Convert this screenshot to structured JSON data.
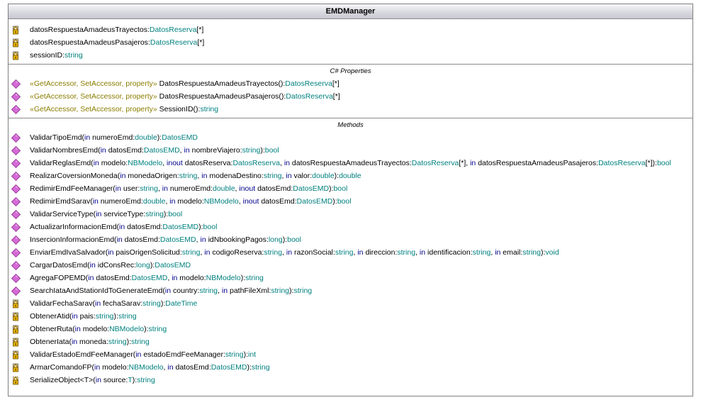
{
  "class_name": "EMDManager",
  "colors": {
    "keyword": "#00008b",
    "type": "#00807f",
    "stereotype": "#8b7d00",
    "method_icon": "#d56ad6"
  },
  "fields": [
    {
      "icon": "lock-icon",
      "parts": [
        {
          "t": "datosRespuestaAmadeusTrayectos:",
          "c": "id"
        },
        {
          "t": "DatosReserva",
          "c": "ty"
        },
        {
          "t": "[*]",
          "c": "id"
        }
      ]
    },
    {
      "icon": "lock-icon",
      "parts": [
        {
          "t": "datosRespuestaAmadeusPasajeros:",
          "c": "id"
        },
        {
          "t": "DatosReserva",
          "c": "ty"
        },
        {
          "t": "[*]",
          "c": "id"
        }
      ]
    },
    {
      "icon": "lock-icon",
      "parts": [
        {
          "t": "sessionID:",
          "c": "id"
        },
        {
          "t": "string",
          "c": "ty"
        }
      ]
    }
  ],
  "properties_header": "C# Properties",
  "properties": [
    {
      "icon": "method-icon",
      "parts": [
        {
          "t": "«GetAccessor, SetAccessor, property» ",
          "c": "st"
        },
        {
          "t": "DatosRespuestaAmadeusTrayectos():",
          "c": "id"
        },
        {
          "t": "DatosReserva",
          "c": "ty"
        },
        {
          "t": "[*]",
          "c": "id"
        }
      ]
    },
    {
      "icon": "method-icon",
      "parts": [
        {
          "t": "«GetAccessor, SetAccessor, property» ",
          "c": "st"
        },
        {
          "t": "DatosRespuestaAmadeusPasajeros():",
          "c": "id"
        },
        {
          "t": "DatosReserva",
          "c": "ty"
        },
        {
          "t": "[*]",
          "c": "id"
        }
      ]
    },
    {
      "icon": "method-icon",
      "parts": [
        {
          "t": "«GetAccessor, SetAccessor, property» ",
          "c": "st"
        },
        {
          "t": "SessionID():",
          "c": "id"
        },
        {
          "t": "string",
          "c": "ty"
        }
      ]
    }
  ],
  "methods_header": "Methods",
  "methods": [
    {
      "icon": "method-icon",
      "parts": [
        {
          "t": "ValidarTipoEmd(",
          "c": "id"
        },
        {
          "t": "in",
          "c": "kw"
        },
        {
          "t": " numeroEmd:",
          "c": "id"
        },
        {
          "t": "double",
          "c": "ty"
        },
        {
          "t": "):",
          "c": "id"
        },
        {
          "t": "DatosEMD",
          "c": "ty"
        }
      ]
    },
    {
      "icon": "method-icon",
      "parts": [
        {
          "t": "ValidarNombresEmd(",
          "c": "id"
        },
        {
          "t": "in",
          "c": "kw"
        },
        {
          "t": " datosEmd:",
          "c": "id"
        },
        {
          "t": "DatosEMD",
          "c": "ty"
        },
        {
          "t": ", ",
          "c": "id"
        },
        {
          "t": "in",
          "c": "kw"
        },
        {
          "t": " nombreViajero:",
          "c": "id"
        },
        {
          "t": "string",
          "c": "ty"
        },
        {
          "t": "):",
          "c": "id"
        },
        {
          "t": "bool",
          "c": "ty"
        }
      ]
    },
    {
      "icon": "method-icon",
      "parts": [
        {
          "t": "ValidarReglasEmd(",
          "c": "id"
        },
        {
          "t": "in",
          "c": "kw"
        },
        {
          "t": " modelo:",
          "c": "id"
        },
        {
          "t": "NBModelo",
          "c": "ty"
        },
        {
          "t": ", ",
          "c": "id"
        },
        {
          "t": "inout",
          "c": "kw"
        },
        {
          "t": " datosReserva:",
          "c": "id"
        },
        {
          "t": "DatosReserva",
          "c": "ty"
        },
        {
          "t": ", ",
          "c": "id"
        },
        {
          "t": "in",
          "c": "kw"
        },
        {
          "t": " datosRespuestaAmadeusTrayectos:",
          "c": "id"
        },
        {
          "t": "DatosReserva",
          "c": "ty"
        },
        {
          "t": "[*], ",
          "c": "id"
        },
        {
          "t": "in",
          "c": "kw"
        },
        {
          "t": " datosRespuestaAmadeusPasajeros:",
          "c": "id"
        },
        {
          "t": "DatosReserva",
          "c": "ty"
        },
        {
          "t": "[*]):",
          "c": "id"
        },
        {
          "t": "bool",
          "c": "ty"
        }
      ]
    },
    {
      "icon": "method-icon",
      "parts": [
        {
          "t": "RealizarCoversionMoneda(",
          "c": "id"
        },
        {
          "t": "in",
          "c": "kw"
        },
        {
          "t": " monedaOrigen:",
          "c": "id"
        },
        {
          "t": "string",
          "c": "ty"
        },
        {
          "t": ", ",
          "c": "id"
        },
        {
          "t": "in",
          "c": "kw"
        },
        {
          "t": " modenaDestino:",
          "c": "id"
        },
        {
          "t": "string",
          "c": "ty"
        },
        {
          "t": ", ",
          "c": "id"
        },
        {
          "t": "in",
          "c": "kw"
        },
        {
          "t": " valor:",
          "c": "id"
        },
        {
          "t": "double",
          "c": "ty"
        },
        {
          "t": "):",
          "c": "id"
        },
        {
          "t": "double",
          "c": "ty"
        }
      ]
    },
    {
      "icon": "method-icon",
      "parts": [
        {
          "t": "RedimirEmdFeeManager(",
          "c": "id"
        },
        {
          "t": "in",
          "c": "kw"
        },
        {
          "t": " user:",
          "c": "id"
        },
        {
          "t": "string",
          "c": "ty"
        },
        {
          "t": ", ",
          "c": "id"
        },
        {
          "t": "in",
          "c": "kw"
        },
        {
          "t": " numeroEmd:",
          "c": "id"
        },
        {
          "t": "double",
          "c": "ty"
        },
        {
          "t": ", ",
          "c": "id"
        },
        {
          "t": "inout",
          "c": "kw"
        },
        {
          "t": " datosEmd:",
          "c": "id"
        },
        {
          "t": "DatosEMD",
          "c": "ty"
        },
        {
          "t": "):",
          "c": "id"
        },
        {
          "t": "bool",
          "c": "ty"
        }
      ]
    },
    {
      "icon": "method-icon",
      "parts": [
        {
          "t": "RedimirEmdSarav(",
          "c": "id"
        },
        {
          "t": "in",
          "c": "kw"
        },
        {
          "t": " numeroEmd:",
          "c": "id"
        },
        {
          "t": "double",
          "c": "ty"
        },
        {
          "t": ", ",
          "c": "id"
        },
        {
          "t": "in",
          "c": "kw"
        },
        {
          "t": " modelo:",
          "c": "id"
        },
        {
          "t": "NBModelo",
          "c": "ty"
        },
        {
          "t": ", ",
          "c": "id"
        },
        {
          "t": "inout",
          "c": "kw"
        },
        {
          "t": " datosEmd:",
          "c": "id"
        },
        {
          "t": "DatosEMD",
          "c": "ty"
        },
        {
          "t": "):",
          "c": "id"
        },
        {
          "t": "bool",
          "c": "ty"
        }
      ]
    },
    {
      "icon": "method-icon",
      "parts": [
        {
          "t": "ValidarServiceType(",
          "c": "id"
        },
        {
          "t": "in",
          "c": "kw"
        },
        {
          "t": " serviceType:",
          "c": "id"
        },
        {
          "t": "string",
          "c": "ty"
        },
        {
          "t": "):",
          "c": "id"
        },
        {
          "t": "bool",
          "c": "ty"
        }
      ]
    },
    {
      "icon": "method-icon",
      "parts": [
        {
          "t": "ActualizarInformacionEmd(",
          "c": "id"
        },
        {
          "t": "in",
          "c": "kw"
        },
        {
          "t": " datosEmd:",
          "c": "id"
        },
        {
          "t": "DatosEMD",
          "c": "ty"
        },
        {
          "t": "):",
          "c": "id"
        },
        {
          "t": "bool",
          "c": "ty"
        }
      ]
    },
    {
      "icon": "method-icon",
      "parts": [
        {
          "t": "InsercionInformacionEmd(",
          "c": "id"
        },
        {
          "t": "in",
          "c": "kw"
        },
        {
          "t": " datosEmd:",
          "c": "id"
        },
        {
          "t": "DatosEMD",
          "c": "ty"
        },
        {
          "t": ", ",
          "c": "id"
        },
        {
          "t": "in",
          "c": "kw"
        },
        {
          "t": " idNbookingPagos:",
          "c": "id"
        },
        {
          "t": "long",
          "c": "ty"
        },
        {
          "t": "):",
          "c": "id"
        },
        {
          "t": "bool",
          "c": "ty"
        }
      ]
    },
    {
      "icon": "method-icon",
      "parts": [
        {
          "t": "EnviarEmdIvaSalvador(",
          "c": "id"
        },
        {
          "t": "in",
          "c": "kw"
        },
        {
          "t": " paisOrigenSolicitud:",
          "c": "id"
        },
        {
          "t": "string",
          "c": "ty"
        },
        {
          "t": ", ",
          "c": "id"
        },
        {
          "t": "in",
          "c": "kw"
        },
        {
          "t": " codigoReserva:",
          "c": "id"
        },
        {
          "t": "string",
          "c": "ty"
        },
        {
          "t": ", ",
          "c": "id"
        },
        {
          "t": "in",
          "c": "kw"
        },
        {
          "t": " razonSocial:",
          "c": "id"
        },
        {
          "t": "string",
          "c": "ty"
        },
        {
          "t": ", ",
          "c": "id"
        },
        {
          "t": "in",
          "c": "kw"
        },
        {
          "t": " direccion:",
          "c": "id"
        },
        {
          "t": "string",
          "c": "ty"
        },
        {
          "t": ", ",
          "c": "id"
        },
        {
          "t": "in",
          "c": "kw"
        },
        {
          "t": " identificacion:",
          "c": "id"
        },
        {
          "t": "string",
          "c": "ty"
        },
        {
          "t": ", ",
          "c": "id"
        },
        {
          "t": "in",
          "c": "kw"
        },
        {
          "t": " email:",
          "c": "id"
        },
        {
          "t": "string",
          "c": "ty"
        },
        {
          "t": "):",
          "c": "id"
        },
        {
          "t": "void",
          "c": "ty"
        }
      ]
    },
    {
      "icon": "method-icon",
      "parts": [
        {
          "t": "CargarDatosEmd(",
          "c": "id"
        },
        {
          "t": "in",
          "c": "kw"
        },
        {
          "t": " idConsRec:",
          "c": "id"
        },
        {
          "t": "long",
          "c": "ty"
        },
        {
          "t": "):",
          "c": "id"
        },
        {
          "t": "DatosEMD",
          "c": "ty"
        }
      ]
    },
    {
      "icon": "method-icon",
      "parts": [
        {
          "t": "AgregaFOPEMD(",
          "c": "id"
        },
        {
          "t": "in",
          "c": "kw"
        },
        {
          "t": " datosEmd:",
          "c": "id"
        },
        {
          "t": "DatosEMD",
          "c": "ty"
        },
        {
          "t": ", ",
          "c": "id"
        },
        {
          "t": "in",
          "c": "kw"
        },
        {
          "t": " modelo:",
          "c": "id"
        },
        {
          "t": "NBModelo",
          "c": "ty"
        },
        {
          "t": "):",
          "c": "id"
        },
        {
          "t": "string",
          "c": "ty"
        }
      ]
    },
    {
      "icon": "method-icon",
      "parts": [
        {
          "t": "SearchIataAndStationIdToGenerateEmd(",
          "c": "id"
        },
        {
          "t": "in",
          "c": "kw"
        },
        {
          "t": " country:",
          "c": "id"
        },
        {
          "t": "string",
          "c": "ty"
        },
        {
          "t": ", ",
          "c": "id"
        },
        {
          "t": "in",
          "c": "kw"
        },
        {
          "t": " pathFileXml:",
          "c": "id"
        },
        {
          "t": "string",
          "c": "ty"
        },
        {
          "t": "):",
          "c": "id"
        },
        {
          "t": "string",
          "c": "ty"
        }
      ]
    },
    {
      "icon": "lock-icon",
      "parts": [
        {
          "t": "ValidarFechaSarav(",
          "c": "id"
        },
        {
          "t": "in",
          "c": "kw"
        },
        {
          "t": " fechaSarav:",
          "c": "id"
        },
        {
          "t": "string",
          "c": "ty"
        },
        {
          "t": "):",
          "c": "id"
        },
        {
          "t": "DateTime",
          "c": "ty"
        }
      ]
    },
    {
      "icon": "lock-icon",
      "parts": [
        {
          "t": "ObtenerAtid(",
          "c": "id"
        },
        {
          "t": "in",
          "c": "kw"
        },
        {
          "t": " pais:",
          "c": "id"
        },
        {
          "t": "string",
          "c": "ty"
        },
        {
          "t": "):",
          "c": "id"
        },
        {
          "t": "string",
          "c": "ty"
        }
      ]
    },
    {
      "icon": "lock-icon",
      "parts": [
        {
          "t": "ObtenerRuta(",
          "c": "id"
        },
        {
          "t": "in",
          "c": "kw"
        },
        {
          "t": " modelo:",
          "c": "id"
        },
        {
          "t": "NBModelo",
          "c": "ty"
        },
        {
          "t": "):",
          "c": "id"
        },
        {
          "t": "string",
          "c": "ty"
        }
      ]
    },
    {
      "icon": "lock-icon",
      "parts": [
        {
          "t": "ObtenerIata(",
          "c": "id"
        },
        {
          "t": "in",
          "c": "kw"
        },
        {
          "t": " moneda:",
          "c": "id"
        },
        {
          "t": "string",
          "c": "ty"
        },
        {
          "t": "):",
          "c": "id"
        },
        {
          "t": "string",
          "c": "ty"
        }
      ]
    },
    {
      "icon": "lock-icon",
      "parts": [
        {
          "t": "ValidarEstadoEmdFeeManager(",
          "c": "id"
        },
        {
          "t": "in",
          "c": "kw"
        },
        {
          "t": " estadoEmdFeeManager:",
          "c": "id"
        },
        {
          "t": "string",
          "c": "ty"
        },
        {
          "t": "):",
          "c": "id"
        },
        {
          "t": "int",
          "c": "ty"
        }
      ]
    },
    {
      "icon": "lock-icon",
      "parts": [
        {
          "t": "ArmarComandoFP(",
          "c": "id"
        },
        {
          "t": "in",
          "c": "kw"
        },
        {
          "t": " modelo:",
          "c": "id"
        },
        {
          "t": "NBModelo",
          "c": "ty"
        },
        {
          "t": ", ",
          "c": "id"
        },
        {
          "t": "in",
          "c": "kw"
        },
        {
          "t": " datosEmd:",
          "c": "id"
        },
        {
          "t": "DatosEMD",
          "c": "ty"
        },
        {
          "t": "):",
          "c": "id"
        },
        {
          "t": "string",
          "c": "ty"
        }
      ]
    },
    {
      "icon": "generic-lock-icon",
      "parts": [
        {
          "t": "SerializeObject<T>(",
          "c": "id"
        },
        {
          "t": "in",
          "c": "kw"
        },
        {
          "t": " source:",
          "c": "id"
        },
        {
          "t": "T",
          "c": "ty"
        },
        {
          "t": "):",
          "c": "id"
        },
        {
          "t": "string",
          "c": "ty"
        }
      ]
    }
  ]
}
